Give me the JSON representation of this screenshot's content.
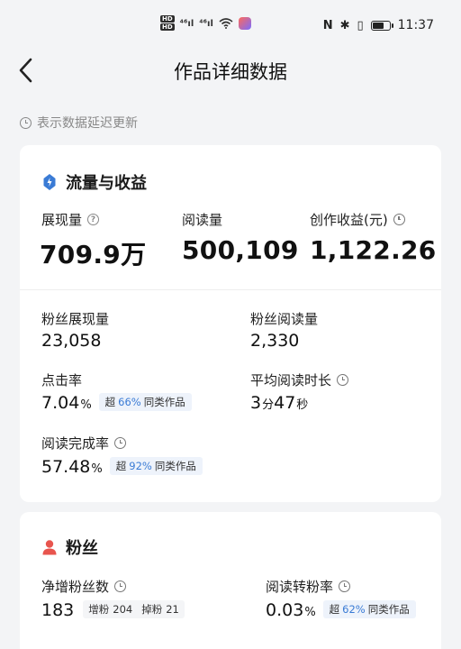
{
  "status_bar": {
    "mini_labels": [
      "HD",
      "HD"
    ],
    "signal_1": "⁴⁶ıl",
    "signal_2": "⁴⁶ıl",
    "nfc": "N",
    "bt": "✱",
    "vibrate": "▯",
    "time": "11:37",
    "battery_level": 0.75
  },
  "header": {
    "title": "作品详细数据"
  },
  "delay_note": "表示数据延迟更新",
  "traffic": {
    "section_title": "流量与收益",
    "impressions_label": "展现量",
    "impressions_value": "709.9万",
    "reads_label": "阅读量",
    "reads_value": "500,109",
    "revenue_label": "创作收益(元)",
    "revenue_value": "1,122.26",
    "fan_impressions_label": "粉丝展现量",
    "fan_impressions_value": "23,058",
    "fan_reads_label": "粉丝阅读量",
    "fan_reads_value": "2,330",
    "ctr_label": "点击率",
    "ctr_value": "7.04",
    "ctr_unit": "%",
    "ctr_badge_prefix": "超",
    "ctr_badge_value": "66%",
    "ctr_badge_suffix": "同类作品",
    "avg_time_label": "平均阅读时长",
    "avg_time_min": "3",
    "avg_time_min_unit": "分",
    "avg_time_sec": "47",
    "avg_time_sec_unit": "秒",
    "completion_label": "阅读完成率",
    "completion_value": "57.48",
    "completion_unit": "%",
    "completion_badge_prefix": "超",
    "completion_badge_value": "92%",
    "completion_badge_suffix": "同类作品"
  },
  "fans": {
    "section_title": "粉丝",
    "net_label": "净增粉丝数",
    "net_value": "183",
    "gain_label": "增粉",
    "gain_value": "204",
    "loss_label": "掉粉",
    "loss_value": "21",
    "conv_label": "阅读转粉率",
    "conv_value": "0.03",
    "conv_unit": "%",
    "conv_badge_prefix": "超",
    "conv_badge_value": "62%",
    "conv_badge_suffix": "同类作品"
  },
  "colors": {
    "accent_blue": "#3a7bd5",
    "fan_red": "#e8554e",
    "background": "#f3f4f6"
  }
}
